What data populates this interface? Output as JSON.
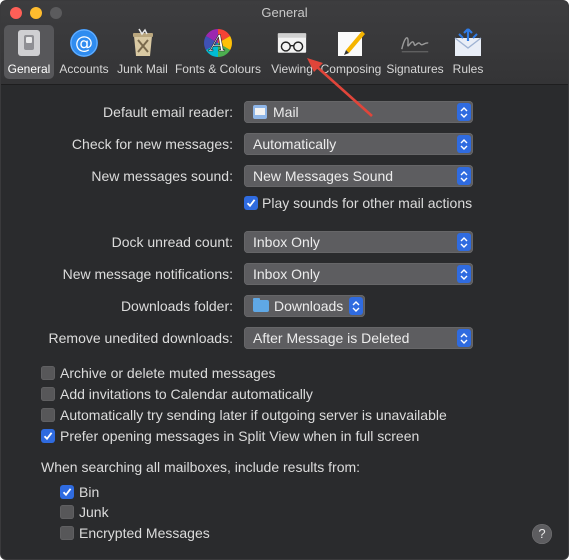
{
  "window": {
    "title": "General"
  },
  "toolbar": {
    "items": [
      {
        "label": "General",
        "icon": "general-switch-icon",
        "active": true
      },
      {
        "label": "Accounts",
        "icon": "at-sign-icon",
        "active": false
      },
      {
        "label": "Junk Mail",
        "icon": "junk-bin-icon",
        "active": false
      },
      {
        "label": "Fonts & Colours",
        "icon": "fonts-colours-icon",
        "active": false
      },
      {
        "label": "Viewing",
        "icon": "glasses-icon",
        "active": false
      },
      {
        "label": "Composing",
        "icon": "pencil-paper-icon",
        "active": false
      },
      {
        "label": "Signatures",
        "icon": "signature-icon",
        "active": false
      },
      {
        "label": "Rules",
        "icon": "rules-envelope-icon",
        "active": false
      }
    ]
  },
  "settings": {
    "default_email_reader": {
      "label": "Default email reader:",
      "value": "Mail",
      "icon": "mail-app-icon"
    },
    "check_new": {
      "label": "Check for new messages:",
      "value": "Automatically"
    },
    "new_sound": {
      "label": "New messages sound:",
      "value": "New Messages Sound"
    },
    "play_sounds": {
      "label": "Play sounds for other mail actions",
      "checked": true
    },
    "dock_unread": {
      "label": "Dock unread count:",
      "value": "Inbox Only"
    },
    "notifications": {
      "label": "New message notifications:",
      "value": "Inbox Only"
    },
    "downloads_folder": {
      "label": "Downloads folder:",
      "value": "Downloads",
      "icon": "folder-icon"
    },
    "remove_unedited": {
      "label": "Remove unedited downloads:",
      "value": "After Message is Deleted"
    }
  },
  "options": [
    {
      "label": "Archive or delete muted messages",
      "checked": false
    },
    {
      "label": "Add invitations to Calendar automatically",
      "checked": false
    },
    {
      "label": "Automatically try sending later if outgoing server is unavailable",
      "checked": false
    },
    {
      "label": "Prefer opening messages in Split View when in full screen",
      "checked": true
    }
  ],
  "search": {
    "heading": "When searching all mailboxes, include results from:",
    "items": [
      {
        "label": "Bin",
        "checked": true
      },
      {
        "label": "Junk",
        "checked": false
      },
      {
        "label": "Encrypted Messages",
        "checked": false
      }
    ]
  },
  "help": {
    "label": "?"
  },
  "colors": {
    "accent": "#2f6be0",
    "annotation_arrow": "#e0453a",
    "window_bg": "#2a2b2d"
  }
}
